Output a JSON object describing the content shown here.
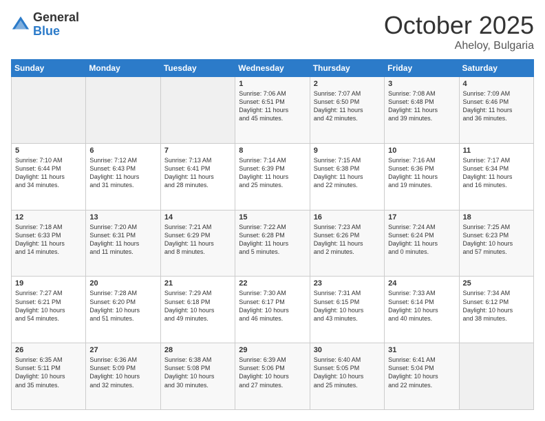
{
  "logo": {
    "general": "General",
    "blue": "Blue"
  },
  "header": {
    "month": "October 2025",
    "location": "Aheloy, Bulgaria"
  },
  "weekdays": [
    "Sunday",
    "Monday",
    "Tuesday",
    "Wednesday",
    "Thursday",
    "Friday",
    "Saturday"
  ],
  "weeks": [
    [
      {
        "day": "",
        "info": ""
      },
      {
        "day": "",
        "info": ""
      },
      {
        "day": "",
        "info": ""
      },
      {
        "day": "1",
        "info": "Sunrise: 7:06 AM\nSunset: 6:51 PM\nDaylight: 11 hours\nand 45 minutes."
      },
      {
        "day": "2",
        "info": "Sunrise: 7:07 AM\nSunset: 6:50 PM\nDaylight: 11 hours\nand 42 minutes."
      },
      {
        "day": "3",
        "info": "Sunrise: 7:08 AM\nSunset: 6:48 PM\nDaylight: 11 hours\nand 39 minutes."
      },
      {
        "day": "4",
        "info": "Sunrise: 7:09 AM\nSunset: 6:46 PM\nDaylight: 11 hours\nand 36 minutes."
      }
    ],
    [
      {
        "day": "5",
        "info": "Sunrise: 7:10 AM\nSunset: 6:44 PM\nDaylight: 11 hours\nand 34 minutes."
      },
      {
        "day": "6",
        "info": "Sunrise: 7:12 AM\nSunset: 6:43 PM\nDaylight: 11 hours\nand 31 minutes."
      },
      {
        "day": "7",
        "info": "Sunrise: 7:13 AM\nSunset: 6:41 PM\nDaylight: 11 hours\nand 28 minutes."
      },
      {
        "day": "8",
        "info": "Sunrise: 7:14 AM\nSunset: 6:39 PM\nDaylight: 11 hours\nand 25 minutes."
      },
      {
        "day": "9",
        "info": "Sunrise: 7:15 AM\nSunset: 6:38 PM\nDaylight: 11 hours\nand 22 minutes."
      },
      {
        "day": "10",
        "info": "Sunrise: 7:16 AM\nSunset: 6:36 PM\nDaylight: 11 hours\nand 19 minutes."
      },
      {
        "day": "11",
        "info": "Sunrise: 7:17 AM\nSunset: 6:34 PM\nDaylight: 11 hours\nand 16 minutes."
      }
    ],
    [
      {
        "day": "12",
        "info": "Sunrise: 7:18 AM\nSunset: 6:33 PM\nDaylight: 11 hours\nand 14 minutes."
      },
      {
        "day": "13",
        "info": "Sunrise: 7:20 AM\nSunset: 6:31 PM\nDaylight: 11 hours\nand 11 minutes."
      },
      {
        "day": "14",
        "info": "Sunrise: 7:21 AM\nSunset: 6:29 PM\nDaylight: 11 hours\nand 8 minutes."
      },
      {
        "day": "15",
        "info": "Sunrise: 7:22 AM\nSunset: 6:28 PM\nDaylight: 11 hours\nand 5 minutes."
      },
      {
        "day": "16",
        "info": "Sunrise: 7:23 AM\nSunset: 6:26 PM\nDaylight: 11 hours\nand 2 minutes."
      },
      {
        "day": "17",
        "info": "Sunrise: 7:24 AM\nSunset: 6:24 PM\nDaylight: 11 hours\nand 0 minutes."
      },
      {
        "day": "18",
        "info": "Sunrise: 7:25 AM\nSunset: 6:23 PM\nDaylight: 10 hours\nand 57 minutes."
      }
    ],
    [
      {
        "day": "19",
        "info": "Sunrise: 7:27 AM\nSunset: 6:21 PM\nDaylight: 10 hours\nand 54 minutes."
      },
      {
        "day": "20",
        "info": "Sunrise: 7:28 AM\nSunset: 6:20 PM\nDaylight: 10 hours\nand 51 minutes."
      },
      {
        "day": "21",
        "info": "Sunrise: 7:29 AM\nSunset: 6:18 PM\nDaylight: 10 hours\nand 49 minutes."
      },
      {
        "day": "22",
        "info": "Sunrise: 7:30 AM\nSunset: 6:17 PM\nDaylight: 10 hours\nand 46 minutes."
      },
      {
        "day": "23",
        "info": "Sunrise: 7:31 AM\nSunset: 6:15 PM\nDaylight: 10 hours\nand 43 minutes."
      },
      {
        "day": "24",
        "info": "Sunrise: 7:33 AM\nSunset: 6:14 PM\nDaylight: 10 hours\nand 40 minutes."
      },
      {
        "day": "25",
        "info": "Sunrise: 7:34 AM\nSunset: 6:12 PM\nDaylight: 10 hours\nand 38 minutes."
      }
    ],
    [
      {
        "day": "26",
        "info": "Sunrise: 6:35 AM\nSunset: 5:11 PM\nDaylight: 10 hours\nand 35 minutes."
      },
      {
        "day": "27",
        "info": "Sunrise: 6:36 AM\nSunset: 5:09 PM\nDaylight: 10 hours\nand 32 minutes."
      },
      {
        "day": "28",
        "info": "Sunrise: 6:38 AM\nSunset: 5:08 PM\nDaylight: 10 hours\nand 30 minutes."
      },
      {
        "day": "29",
        "info": "Sunrise: 6:39 AM\nSunset: 5:06 PM\nDaylight: 10 hours\nand 27 minutes."
      },
      {
        "day": "30",
        "info": "Sunrise: 6:40 AM\nSunset: 5:05 PM\nDaylight: 10 hours\nand 25 minutes."
      },
      {
        "day": "31",
        "info": "Sunrise: 6:41 AM\nSunset: 5:04 PM\nDaylight: 10 hours\nand 22 minutes."
      },
      {
        "day": "",
        "info": ""
      }
    ]
  ]
}
